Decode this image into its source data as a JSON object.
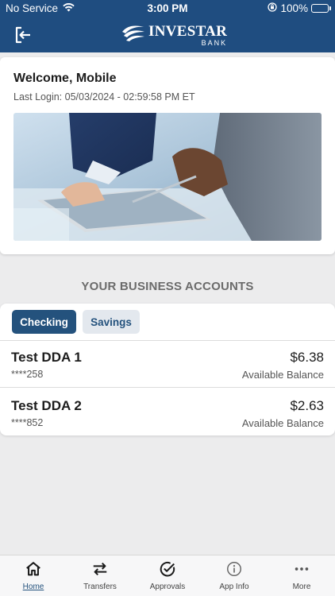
{
  "status_bar": {
    "carrier": "No Service",
    "time": "3:00 PM",
    "battery": "100%",
    "icons": [
      "wifi-icon",
      "rotation-lock-icon",
      "battery-charging-icon"
    ]
  },
  "header": {
    "brand": "INVESTAR",
    "brand_sub": "BANK",
    "logout_icon": "logout-icon"
  },
  "welcome": {
    "title": "Welcome, Mobile",
    "last_login": "Last Login: 05/03/2024 - 02:59:58 PM ET"
  },
  "accounts_section": {
    "title": "YOUR BUSINESS ACCOUNTS",
    "tabs": [
      {
        "label": "Checking",
        "active": true
      },
      {
        "label": "Savings",
        "active": false
      }
    ],
    "accounts": [
      {
        "name": "Test DDA 1",
        "masked": "****258",
        "amount": "$6.38",
        "balance_label": "Available Balance"
      },
      {
        "name": "Test DDA 2",
        "masked": "****852",
        "amount": "$2.63",
        "balance_label": "Available Balance"
      }
    ]
  },
  "tabbar": {
    "items": [
      {
        "label": "Home",
        "icon": "home-icon",
        "active": true
      },
      {
        "label": "Transfers",
        "icon": "transfer-arrows-icon",
        "active": false
      },
      {
        "label": "Approvals",
        "icon": "check-circle-icon",
        "active": false
      },
      {
        "label": "App Info",
        "icon": "info-icon",
        "active": false
      },
      {
        "label": "More",
        "icon": "more-dots-icon",
        "active": false
      }
    ]
  },
  "colors": {
    "header_bg": "#1f4d80",
    "accent": "#24527d",
    "battery_green": "#49d05a"
  }
}
